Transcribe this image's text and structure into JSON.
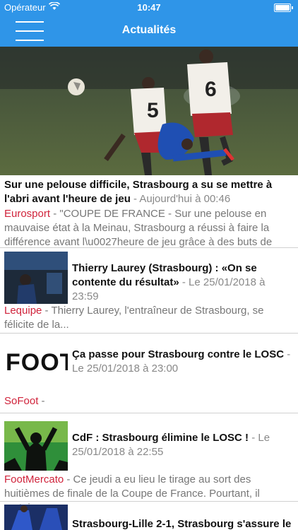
{
  "status": {
    "carrier": "Opérateur",
    "time": "10:47"
  },
  "navbar": {
    "title": "Actualités"
  },
  "hero": {
    "title": "Sur une pelouse difficile, Strasbourg a su se mettre à l'abri avant l'heure de jeu",
    "meta": " - Aujourd'hui à 00:46",
    "source": "Eurosport",
    "snippet": " - \"COUPE DE FRANCE - Sur une pelouse en mauvaise état à la Meinau, Strasbourg a réussi à faire la différence avant l\\u0027heure de jeu grâce à des buts de Da..."
  },
  "articles": [
    {
      "title": "Thierry Laurey (Strasbourg) : «On se contente du résultat»",
      "meta": " - Le 25/01/2018 à 23:59",
      "source": "Lequipe",
      "snippet": " - Thierry Laurey, l'entraîneur de Strasbourg, se félicite de la..."
    },
    {
      "title": "Ça passe pour Strasbourg contre le LOSC",
      "meta": " - Le 25/01/2018 à 23:00",
      "source": "SoFoot",
      "snippet": " -",
      "logo_text": "FOOT"
    },
    {
      "title": "CdF : Strasbourg élimine le LOSC !",
      "meta": " - Le 25/01/2018 à 22:55",
      "source": "FootMercato",
      "snippet": " - Ce jeudi a eu lieu le tirage au sort des huitièmes de finale de la Coupe de France. Pourtant, il restai..."
    },
    {
      "title": "Strasbourg-Lille 2-1, Strasbourg s'assure le"
    }
  ]
}
